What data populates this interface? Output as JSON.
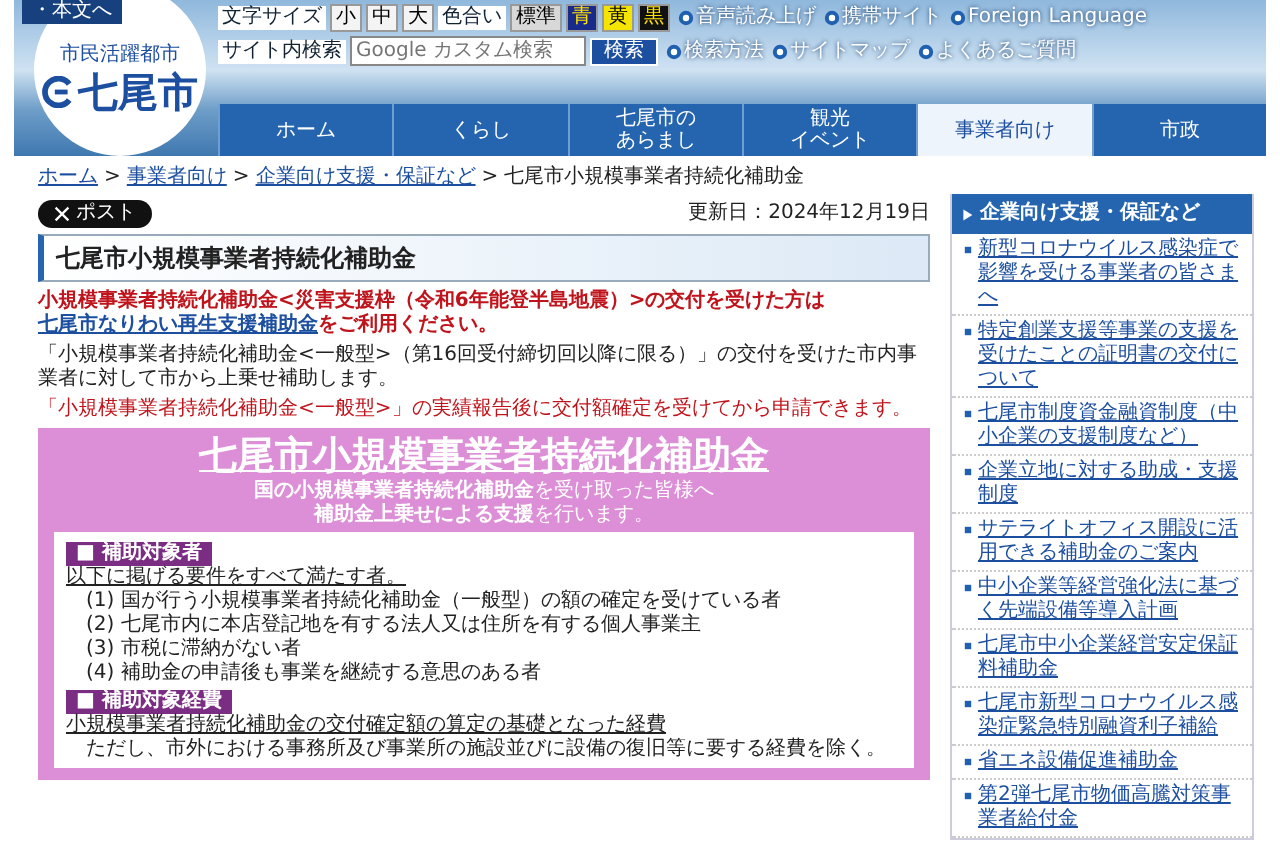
{
  "skip_link": "・本文へ",
  "logo": {
    "tagline": "市民活躍都市",
    "name": "七尾市"
  },
  "utility": {
    "font_size_label": "文字サイズ",
    "font_sizes": [
      "小",
      "中",
      "大"
    ],
    "color_label": "色合い",
    "color_options": [
      {
        "label": "標準",
        "color": "#d8d8d8"
      },
      {
        "label": "青",
        "color": "#1a2a8a"
      },
      {
        "label": "黄",
        "color": "#f4e400"
      },
      {
        "label": "黒",
        "color": "#111111"
      }
    ],
    "links_top": [
      "音声読み上げ",
      "携帯サイト",
      "Foreign Language"
    ],
    "search_label": "サイト内検索",
    "search": {
      "placeholder": "Google カスタム検索"
    },
    "search_button": "検索",
    "links_bottom": [
      "検索方法",
      "サイトマップ",
      "よくあるご質問"
    ]
  },
  "nav": [
    {
      "label": "ホーム",
      "selected": false
    },
    {
      "label": "くらし",
      "selected": false
    },
    {
      "lines": [
        "七尾市の",
        "あらまし"
      ],
      "selected": false
    },
    {
      "lines": [
        "観光",
        "イベント"
      ],
      "selected": false
    },
    {
      "label": "事業者向け",
      "selected": true
    },
    {
      "label": "市政",
      "selected": false
    }
  ],
  "breadcrumb": {
    "links": [
      "ホーム",
      "事業者向け",
      "企業向け支援・保証など"
    ],
    "separator": ">",
    "current": "七尾市小規模事業者持続化補助金"
  },
  "post_button": "ポスト",
  "updated": "更新日：2024年12月19日",
  "page_title": "七尾市小規模事業者持続化補助金",
  "notice": {
    "text": "小規模事業者持続化補助金<災害支援枠（令和6年能登半島地震）>の交付を受けた方は",
    "link": "七尾市なりわい再生支援補助金",
    "after": "をご利用ください。"
  },
  "paragraphs": [
    {
      "kind": "plain",
      "text": "「小規模事業者持続化補助金<一般型>（第16回受付締切回以降に限る）」の交付を受けた市内事業者に対して市から上乗せ補助します。"
    },
    {
      "kind": "alert",
      "text": "「小規模事業者持続化補助金<一般型>」の実績報告後に交付額確定を受けてから申請できます。"
    }
  ],
  "flyer": {
    "title": "七尾市小規模事業者持続化補助金",
    "subtitle": [
      "**国の小規模事業者持続化補助金**を受け取った皆様へ",
      "**補助金上乗せによる支援**を行います。"
    ],
    "sections": [
      {
        "heading": "■ 補助対象者",
        "lead": "以下に掲げる要件をすべて満たす者。",
        "items": [
          "(1) 国が行う小規模事業者持続化補助金（一般型）の額の確定を受けている者",
          "(2) 七尾市内に本店登記地を有する法人又は住所を有する個人事業主",
          "(3) 市税に滞納がない者",
          "(4) 補助金の申請後も事業を継続する意思のある者"
        ]
      },
      {
        "heading": "■ 補助対象経費",
        "lead": "小規模事業者持続化補助金の交付確定額の算定の基礎となった経費",
        "items": [
          "ただし、市外における事務所及び事業所の施設並びに設備の復旧等に要する経費を除く。"
        ]
      }
    ]
  },
  "sidebar": {
    "title": "企業向け支援・保証など",
    "items": [
      "新型コロナウイルス感染症で影響を受ける事業者の皆さまへ",
      "特定創業支援等事業の支援を受けたことの証明書の交付について",
      "七尾市制度資金融資制度（中小企業の支援制度など）",
      "企業立地に対する助成・支援制度",
      "サテライトオフィス開設に活用できる補助金のご案内",
      "中小企業等経営強化法に基づく先端設備等導入計画",
      "七尾市中小企業経営安定保証料補助金",
      "七尾市新型コロナウイルス感染症緊急特別融資利子補給",
      "省エネ設備促進補助金",
      "第2弾七尾市物価高騰対策事業者給付金"
    ]
  }
}
